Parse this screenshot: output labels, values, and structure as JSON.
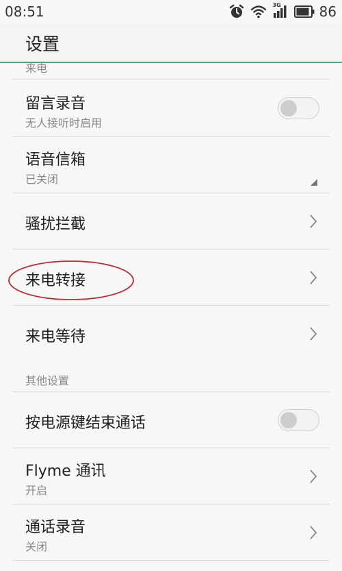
{
  "status_bar": {
    "time": "08:51",
    "network": "3G",
    "battery": "86"
  },
  "header": {
    "title": "设置"
  },
  "sections": {
    "incoming": {
      "label": "来电"
    },
    "other": {
      "label": "其他设置"
    }
  },
  "rows": {
    "voicemail_record": {
      "title": "留言录音",
      "subtitle": "无人接听时启用",
      "toggle_on": false
    },
    "voice_mailbox": {
      "title": "语音信箱",
      "subtitle": "已关闭"
    },
    "harassment_block": {
      "title": "骚扰拦截"
    },
    "call_forwarding": {
      "title": "来电转接"
    },
    "call_waiting": {
      "title": "来电等待"
    },
    "power_key_end_call": {
      "title": "按电源键结束通话",
      "toggle_on": false
    },
    "flyme_comm": {
      "title": "Flyme 通讯",
      "subtitle": "开启"
    },
    "call_recording": {
      "title": "通话录音",
      "subtitle": "关闭"
    }
  },
  "colors": {
    "accent_line": "#3db07a",
    "annotation": "#c0282d",
    "background": "#f7f7f7"
  }
}
